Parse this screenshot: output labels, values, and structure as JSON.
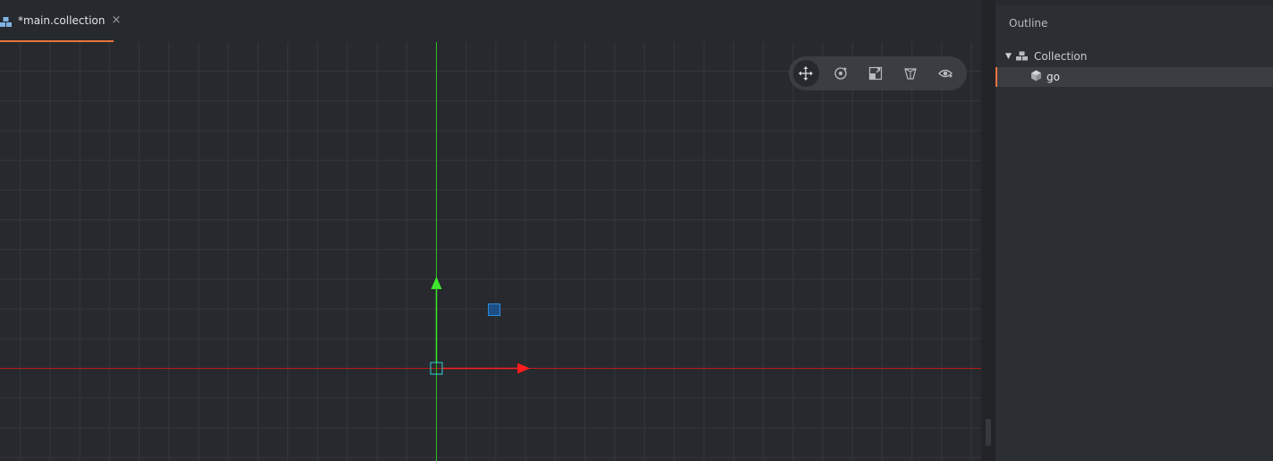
{
  "tab": {
    "label": "*main.collection",
    "close_glyph": "×",
    "icon": "collection-icon"
  },
  "viewport": {
    "grid": true,
    "x_axis_color": "#cc2020",
    "y_axis_color": "#29c41f",
    "selection_color": "#2a8bd8"
  },
  "toolbar": {
    "tools": [
      {
        "name": "move-tool",
        "icon": "move-icon",
        "active": true
      },
      {
        "name": "rotate-tool",
        "icon": "rotate-icon",
        "active": false
      },
      {
        "name": "scale-tool",
        "icon": "scale-icon",
        "active": false
      },
      {
        "name": "perspective-tool",
        "icon": "perspective-icon",
        "active": false
      },
      {
        "name": "visibility-tool",
        "icon": "eye-icon",
        "active": false
      }
    ]
  },
  "outline": {
    "title": "Outline",
    "root": {
      "label": "Collection",
      "icon": "collection-icon",
      "expanded": true
    },
    "children": [
      {
        "label": "go",
        "icon": "game-object-icon",
        "selected": true
      }
    ]
  },
  "colors": {
    "accent": "#e8743f",
    "background": "#26292e",
    "panel": "#2b2e33"
  }
}
